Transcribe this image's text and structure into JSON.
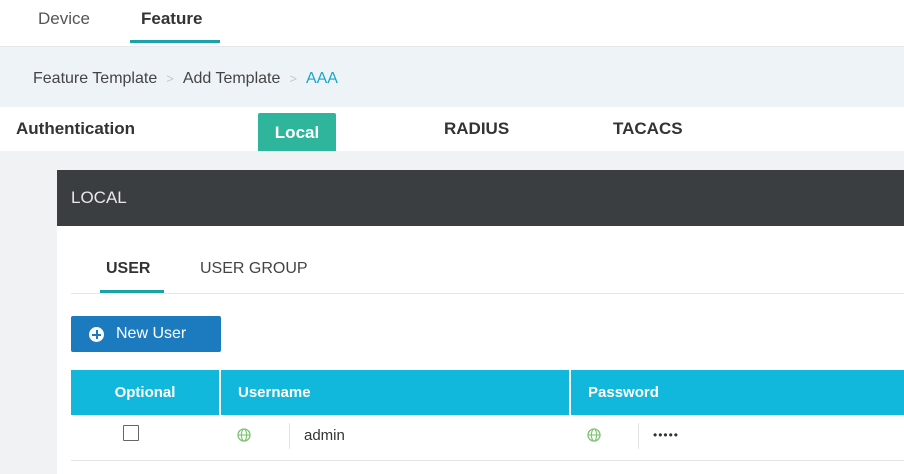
{
  "top_tabs": {
    "device": "Device",
    "feature": "Feature",
    "active": "Feature"
  },
  "breadcrumb": {
    "items": [
      "Feature Template",
      "Add Template",
      "AAA"
    ],
    "separator": ">"
  },
  "authentication": {
    "label": "Authentication",
    "tabs": [
      "Local",
      "RADIUS",
      "TACACS"
    ],
    "active": "Local"
  },
  "panel": {
    "title": "LOCAL",
    "sub_tabs": [
      "USER",
      "USER GROUP"
    ],
    "active_sub_tab": "USER",
    "new_user_button": "New User",
    "table": {
      "columns": [
        "Optional",
        "Username",
        "Password"
      ],
      "rows": [
        {
          "optional": false,
          "username": "admin",
          "password": "•••••"
        }
      ]
    }
  },
  "colors": {
    "accent_teal": "#1ba1a8",
    "local_tab": "#2fb59c",
    "panel_header": "#3b3e41",
    "button_blue": "#1b7bbe",
    "table_header": "#12b8db",
    "breadcrumb_link": "#1aa6c8",
    "globe_icon": "#7cc46f"
  },
  "icons": {
    "new_user": "plus-circle-icon",
    "scope": "globe-icon"
  }
}
